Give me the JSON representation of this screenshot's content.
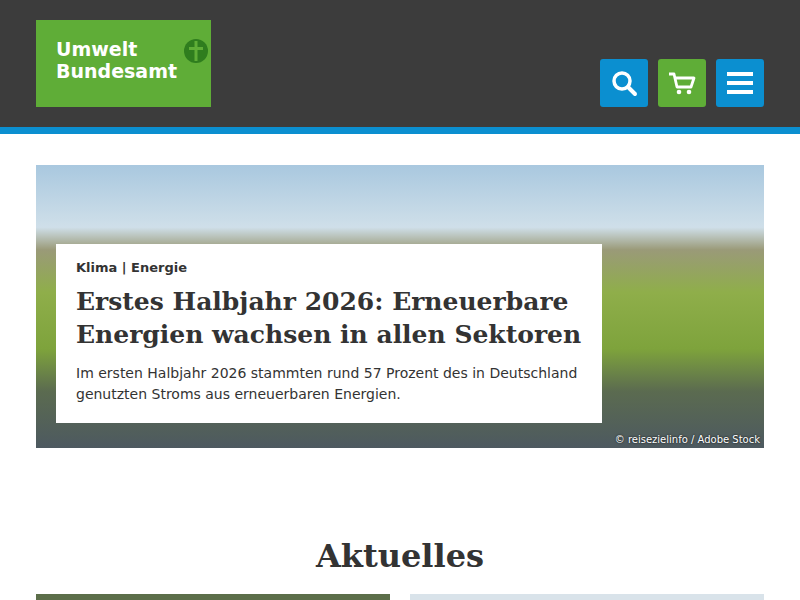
{
  "header": {
    "logo": {
      "lines": [
        "Umwelt",
        "Bundesamt"
      ]
    },
    "buttons": [
      {
        "kind": "search",
        "color": "#0b8fd0"
      },
      {
        "kind": "cart",
        "color": "#5fad37"
      },
      {
        "kind": "menu",
        "color": "#0b8fd0"
      }
    ]
  },
  "hero": {
    "tag": "Klima | Energie",
    "title": "Erstes Halbjahr 2026: Erneuerbare Energien wachsen in allen Sektoren",
    "text": "Im ersten Halbjahr 2026 stammten rund 57 Prozent des in Deutschland genutzten Stroms aus erneuerbaren Energien.",
    "credit": "© reisezielinfo / Adobe Stock"
  },
  "section": {
    "title": "Aktuelles"
  }
}
